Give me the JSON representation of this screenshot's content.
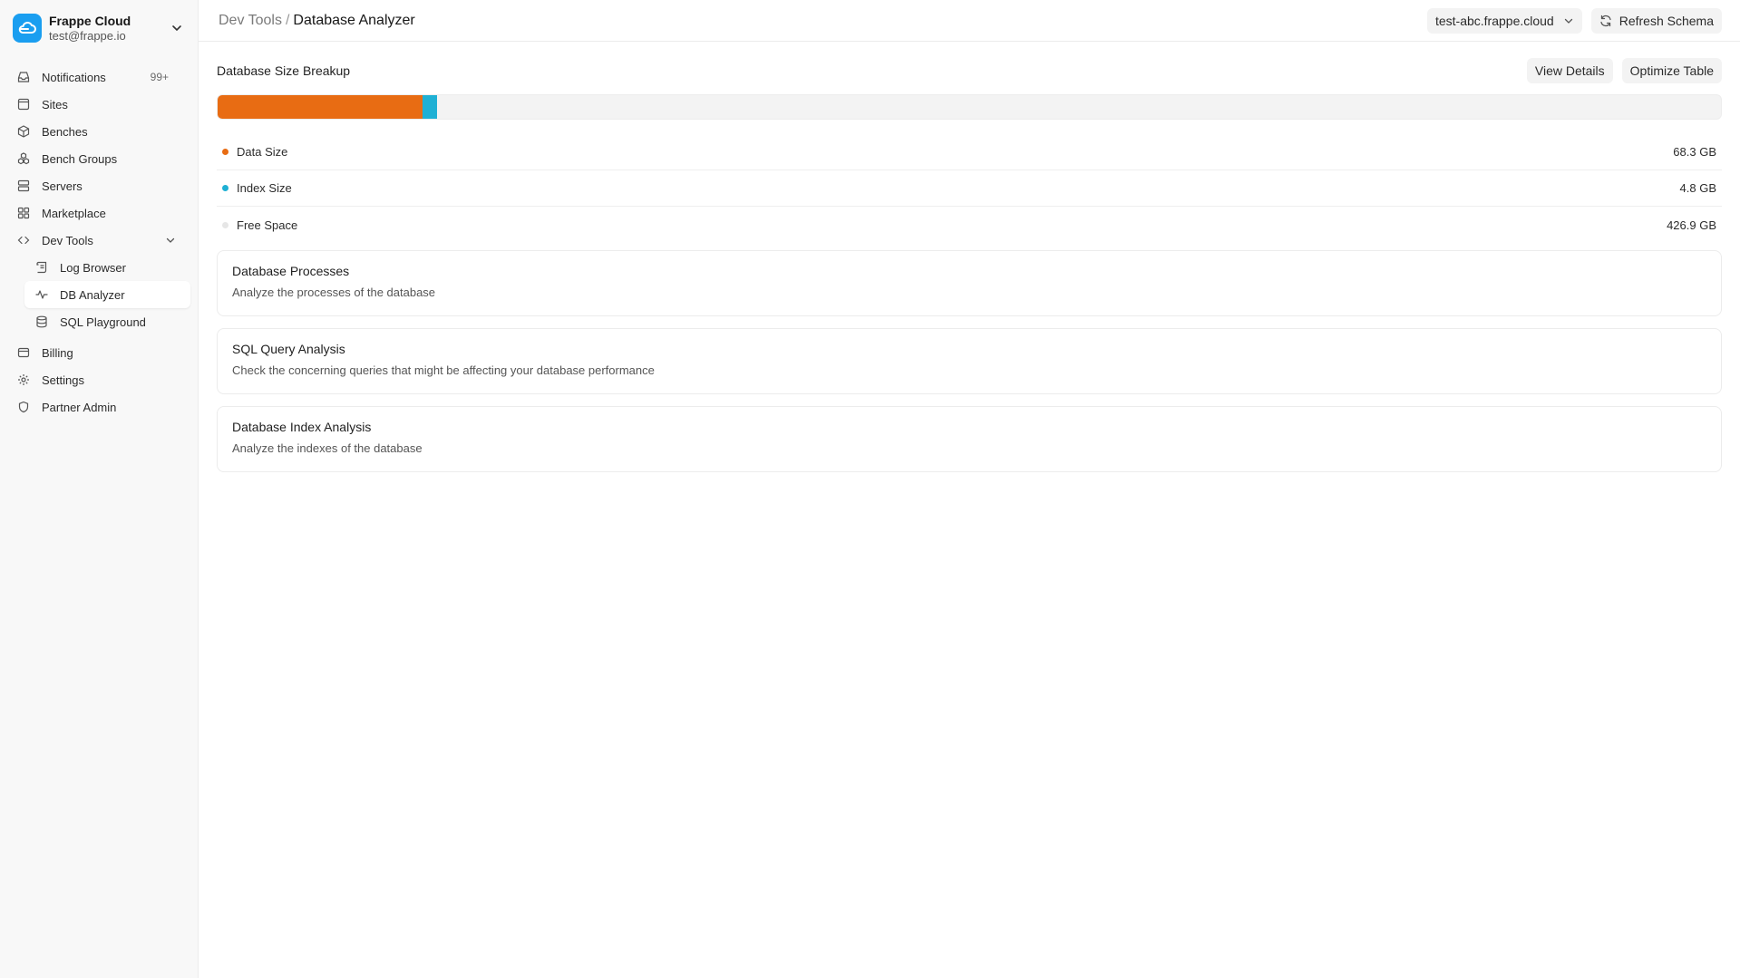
{
  "brand": {
    "name": "Frappe Cloud",
    "email": "test@frappe.io",
    "color": "#1a9ef0"
  },
  "sidebar": {
    "items": [
      {
        "label": "Notifications",
        "icon": "inbox-icon",
        "badge": "99+"
      },
      {
        "label": "Sites",
        "icon": "browser-icon"
      },
      {
        "label": "Benches",
        "icon": "package-icon"
      },
      {
        "label": "Bench Groups",
        "icon": "boxes-icon"
      },
      {
        "label": "Servers",
        "icon": "server-icon"
      },
      {
        "label": "Marketplace",
        "icon": "grid-icon"
      },
      {
        "label": "Dev Tools",
        "icon": "code-icon",
        "expanded": true
      }
    ],
    "dev_tools_children": [
      {
        "label": "Log Browser",
        "icon": "scroll-icon"
      },
      {
        "label": "DB Analyzer",
        "icon": "activity-icon",
        "active": true
      },
      {
        "label": "SQL Playground",
        "icon": "database-icon"
      }
    ],
    "bottom_items": [
      {
        "label": "Billing",
        "icon": "wallet-icon"
      },
      {
        "label": "Settings",
        "icon": "gear-icon"
      },
      {
        "label": "Partner Admin",
        "icon": "shield-icon"
      }
    ]
  },
  "header": {
    "breadcrumb_parent": "Dev Tools",
    "breadcrumb_separator": "/",
    "breadcrumb_current": "Database Analyzer",
    "site_selector": "test-abc.frappe.cloud",
    "refresh_label": "Refresh Schema"
  },
  "size_breakup": {
    "title": "Database Size Breakup",
    "view_details_label": "View Details",
    "optimize_label": "Optimize Table",
    "segments": [
      {
        "label": "Data Size",
        "value": "68.3 GB",
        "gb": 68.3,
        "color": "#e86c13"
      },
      {
        "label": "Index Size",
        "value": "4.8 GB",
        "gb": 4.8,
        "color": "#1fb0d4"
      },
      {
        "label": "Free Space",
        "value": "426.9 GB",
        "gb": 426.9,
        "color": "#e6e6e6"
      }
    ]
  },
  "cards": [
    {
      "title": "Database Processes",
      "desc": "Analyze the processes of the database"
    },
    {
      "title": "SQL Query Analysis",
      "desc": "Check the concerning queries that might be affecting your database performance"
    },
    {
      "title": "Database Index Analysis",
      "desc": "Analyze the indexes of the database"
    }
  ]
}
